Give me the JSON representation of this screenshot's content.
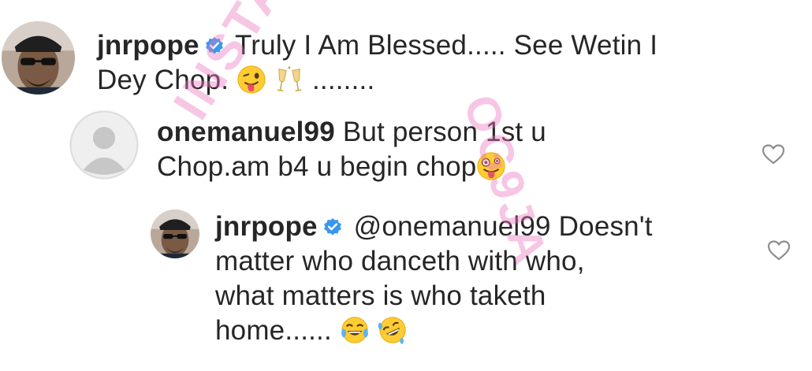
{
  "comments": [
    {
      "username": "jnrpope",
      "verified": true,
      "line1": "Truly I Am Blessed..... See Wetin I",
      "line2": "Dey Chop.",
      "trailing": "........",
      "emojis": [
        "winking-tongue-emoji",
        "clinking-glasses-emoji"
      ]
    },
    {
      "username": "onemanuel99",
      "verified": false,
      "line1": "But person 1st u",
      "line2": "Chop.am b4 u begin chop",
      "emojis": [
        "zany-face-emoji"
      ]
    },
    {
      "username": "jnrpope",
      "verified": true,
      "mention": "@onemanuel99",
      "line1_rest": "Doesn't",
      "line2": "matter who danceth with who,",
      "line3": "what matters is who taketh",
      "line4": "home......",
      "emojis": [
        "tears-of-joy-emoji",
        "rolling-laughing-emoji"
      ]
    }
  ],
  "watermark": {
    "text1": "INSTABL",
    "text2": "OG9JA"
  },
  "colors": {
    "text": "#262626",
    "verified_blue": "#3897f0",
    "heart_outline": "#8e8e8e",
    "watermark": "#ec78be"
  },
  "icons": {
    "like": "heart-outline-icon",
    "verified": "verified-badge-icon"
  }
}
